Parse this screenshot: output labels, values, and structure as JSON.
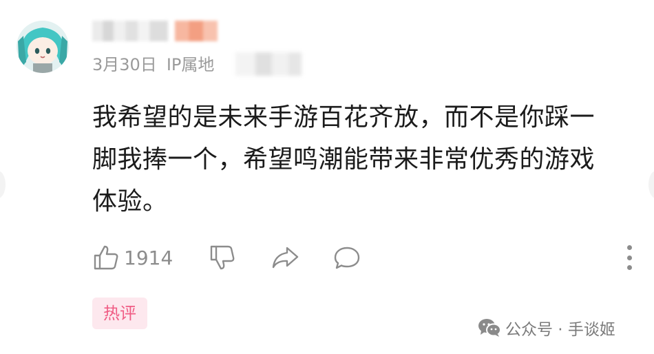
{
  "comment": {
    "date": "3月30日",
    "ip_label": "IP属地",
    "lines": [
      "我希望的是未来手游百花齐放，而不是你踩一",
      "脚我捧一个，希望鸣潮能带来非常优秀的游戏",
      "体验。"
    ],
    "like_count": "1914",
    "tag": "热评"
  },
  "watermark": {
    "text": "公众号 · 手谈姬"
  },
  "colors": {
    "tag_bg": "#fde8ee",
    "tag_text": "#f05c84",
    "meta_text": "#9a9a9a",
    "icon_gray": "#8c8c8c"
  },
  "icons": [
    "thumbs-up-icon",
    "thumbs-down-icon",
    "share-icon",
    "reply-icon",
    "more-icon",
    "wechat-icon"
  ]
}
